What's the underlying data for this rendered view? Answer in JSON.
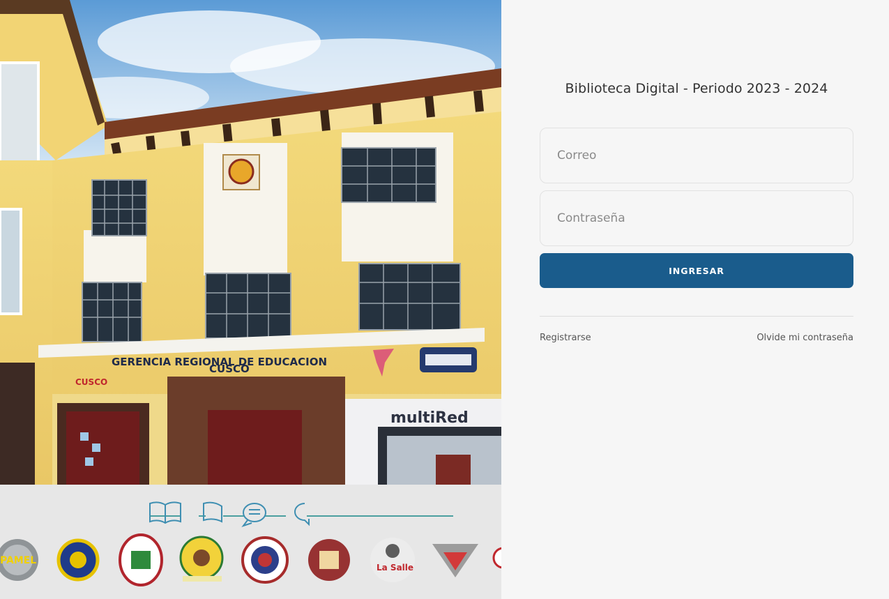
{
  "hero": {
    "building_sign_line1": "GERENCIA REGIONAL DE EDUCACION",
    "building_sign_line2": "CUSCO",
    "side_sign": "CUSCO",
    "bank_sign": "multiRed",
    "logos": [
      "PAMEL",
      "",
      "",
      "",
      "",
      "",
      "La Salle",
      "",
      ""
    ]
  },
  "login": {
    "title": "Biblioteca Digital - Periodo 2023 - 2024",
    "email_placeholder": "Correo",
    "password_placeholder": "Contraseña",
    "submit_label": "INGRESAR",
    "register_label": "Registrarse",
    "forgot_label": "Olvide mi contraseña"
  },
  "colors": {
    "accent": "#1a5c8c",
    "panel_bg": "#f6f6f6"
  }
}
